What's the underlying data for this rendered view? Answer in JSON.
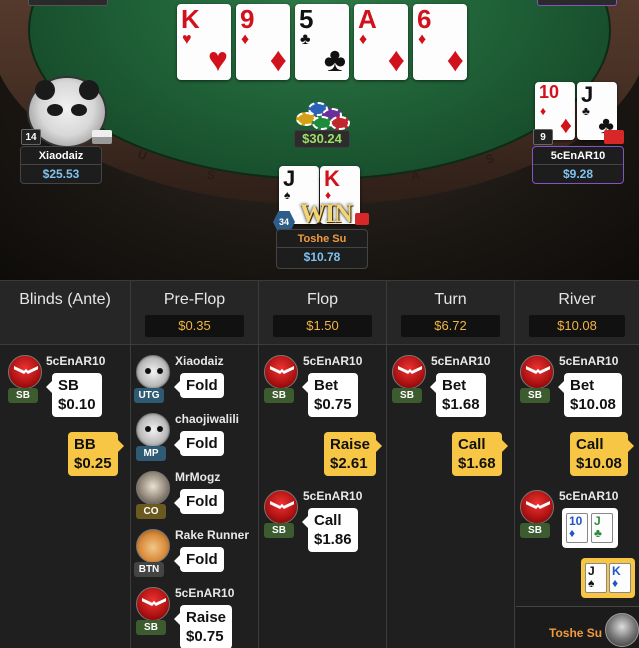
{
  "table": {
    "board_cards": [
      {
        "rank": "K",
        "suit": "♥",
        "color": "red"
      },
      {
        "rank": "9",
        "suit": "♦",
        "color": "red"
      },
      {
        "rank": "5",
        "suit": "♣",
        "color": "blk"
      },
      {
        "rank": "A",
        "suit": "♦",
        "color": "red"
      },
      {
        "rank": "6",
        "suit": "♦",
        "color": "red"
      }
    ],
    "pot": "$30.24",
    "rail_letters": [
      "U",
      "S",
      "A",
      "S"
    ],
    "players": {
      "left": {
        "name": "Xiaodaiz",
        "stack": "$25.53",
        "seat_number": "14"
      },
      "right": {
        "name": "5cEnAR10",
        "stack": "$9.28",
        "seat_number": "9",
        "hole_cards": [
          {
            "rank": "10",
            "suit": "♦",
            "color": "red"
          },
          {
            "rank": "J",
            "suit": "♣",
            "color": "blk"
          }
        ]
      },
      "hero": {
        "name": "Toshe Su",
        "stack": "$10.78",
        "seat_number": "34",
        "hole_cards": [
          {
            "rank": "J",
            "suit": "♠",
            "color": "blk"
          },
          {
            "rank": "K",
            "suit": "♦",
            "color": "red"
          }
        ],
        "win_label": "WIN"
      }
    }
  },
  "history": {
    "columns": [
      {
        "title": "Blinds (Ante)",
        "pot": ""
      },
      {
        "title": "Pre-Flop",
        "pot": "$0.35"
      },
      {
        "title": "Flop",
        "pot": "$1.50"
      },
      {
        "title": "Turn",
        "pot": "$6.72"
      },
      {
        "title": "River",
        "pot": "$10.08"
      }
    ],
    "blinds": {
      "sb": {
        "name": "5cEnAR10",
        "pos": "SB",
        "action": "SB",
        "amount": "$0.10"
      },
      "bb": {
        "action": "BB",
        "amount": "$0.25"
      }
    },
    "preflop": [
      {
        "name": "Xiaodaiz",
        "pos": "UTG",
        "action": "Fold"
      },
      {
        "name": "chaojiwalili",
        "pos": "MP",
        "action": "Fold"
      },
      {
        "name": "MrMogz",
        "pos": "CO",
        "action": "Fold"
      },
      {
        "name": "Rake Runner",
        "pos": "BTN",
        "action": "Fold"
      },
      {
        "name": "5cEnAR10",
        "pos": "SB",
        "action": "Raise",
        "amount": "$0.75"
      }
    ],
    "flop": {
      "bet": {
        "name": "5cEnAR10",
        "pos": "SB",
        "action": "Bet",
        "amount": "$0.75"
      },
      "raise": {
        "action": "Raise",
        "amount": "$2.61"
      },
      "call": {
        "name": "5cEnAR10",
        "pos": "SB",
        "action": "Call",
        "amount": "$1.86"
      }
    },
    "turn": {
      "bet": {
        "name": "5cEnAR10",
        "pos": "SB",
        "action": "Bet",
        "amount": "$1.68"
      },
      "call": {
        "action": "Call",
        "amount": "$1.68"
      }
    },
    "river": {
      "bet": {
        "name": "5cEnAR10",
        "pos": "SB",
        "action": "Bet",
        "amount": "$10.08"
      },
      "call": {
        "action": "Call",
        "amount": "$10.08"
      },
      "show": {
        "name": "5cEnAR10",
        "pos": "SB",
        "cards": [
          {
            "rank": "10",
            "suit": "♦",
            "color": "#2055c9"
          },
          {
            "rank": "J",
            "suit": "♣",
            "color": "#2a8a3a"
          }
        ]
      },
      "hero_cards": [
        {
          "rank": "J",
          "suit": "♠",
          "color": "#111"
        },
        {
          "rank": "K",
          "suit": "♦",
          "color": "#2055c9"
        }
      ],
      "winner": "Toshe Su"
    }
  }
}
